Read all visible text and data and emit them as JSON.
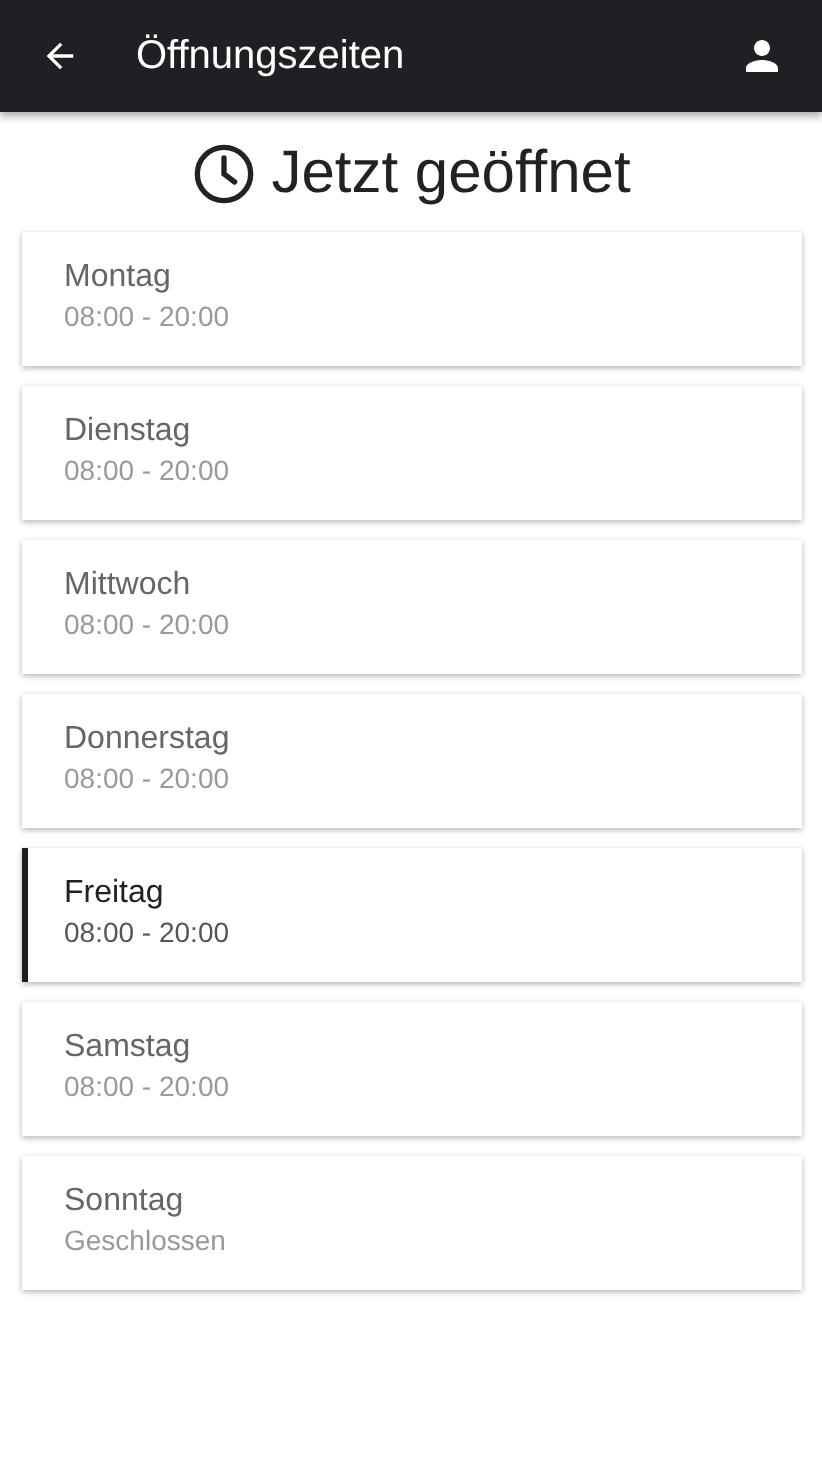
{
  "app_bar": {
    "title": "Öffnungszeiten"
  },
  "status": "Jetzt geöffnet",
  "days": [
    {
      "day": "Montag",
      "hours": "08:00 - 20:00",
      "selected": false
    },
    {
      "day": "Dienstag",
      "hours": "08:00 - 20:00",
      "selected": false
    },
    {
      "day": "Mittwoch",
      "hours": "08:00 - 20:00",
      "selected": false
    },
    {
      "day": "Donnerstag",
      "hours": "08:00 - 20:00",
      "selected": false
    },
    {
      "day": "Freitag",
      "hours": "08:00 - 20:00",
      "selected": true
    },
    {
      "day": "Samstag",
      "hours": "08:00 - 20:00",
      "selected": false
    },
    {
      "day": "Sonntag",
      "hours": "Geschlossen",
      "selected": false
    }
  ]
}
